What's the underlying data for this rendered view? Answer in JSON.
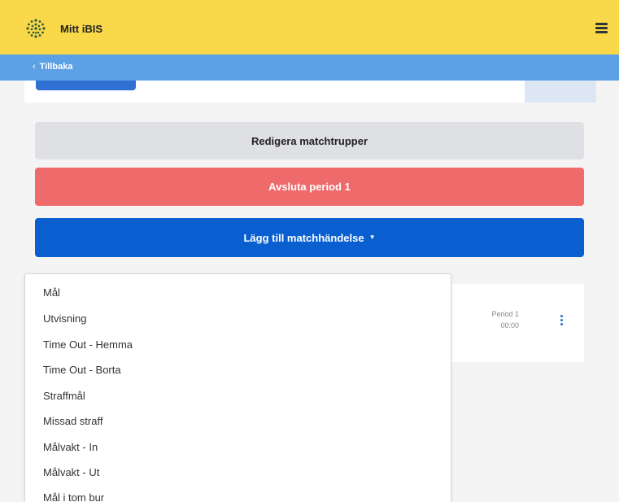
{
  "header": {
    "brand": "Mitt iBIS",
    "logo_icon": "ibis-logo-icon",
    "menu_icon": "hamburger-menu-icon"
  },
  "nav": {
    "back_label": "Tillbaka",
    "back_chevron": "‹"
  },
  "actions": {
    "edit_squads_label": "Redigera matchtrupper",
    "end_period_label": "Avsluta period 1",
    "add_event_label": "Lägg till matchhändelse",
    "add_event_caret": "▼"
  },
  "event": {
    "period": "Period 1",
    "time": "00:00"
  },
  "dropdown": {
    "items": [
      "Mål",
      "Utvisning",
      "Time Out - Hemma",
      "Time Out - Borta",
      "Straffmål",
      "Missad straff",
      "Målvakt - In",
      "Målvakt - Ut",
      "Mål i tom bur"
    ]
  },
  "colors": {
    "header_bg": "#f9d84a",
    "backbar_bg": "#5ca0e6",
    "danger": "#ef6a6a",
    "primary": "#0a5fd0",
    "neutral": "#dfe0e3"
  }
}
